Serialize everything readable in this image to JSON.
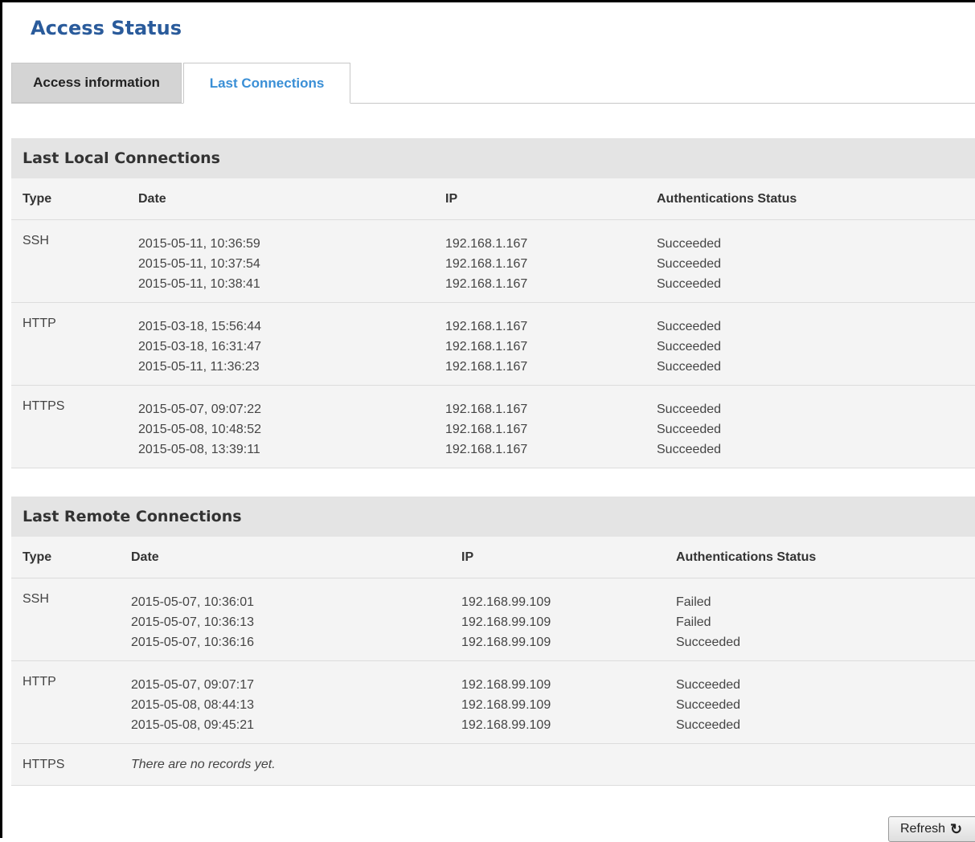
{
  "page_title": "Access Status",
  "tabs": [
    {
      "label": "Access information",
      "active": false
    },
    {
      "label": "Last Connections",
      "active": true
    }
  ],
  "columns": {
    "type": "Type",
    "date": "Date",
    "ip": "IP",
    "status": "Authentications Status"
  },
  "local": {
    "title": "Last Local Connections",
    "groups": [
      {
        "type": "SSH",
        "dates": "2015-05-11, 10:36:59\n2015-05-11, 10:37:54\n2015-05-11, 10:38:41",
        "ips": "192.168.1.167\n192.168.1.167\n192.168.1.167",
        "statuses": "Succeeded\nSucceeded\nSucceeded"
      },
      {
        "type": "HTTP",
        "dates": "2015-03-18, 15:56:44\n2015-03-18, 16:31:47\n2015-05-11, 11:36:23",
        "ips": "192.168.1.167\n192.168.1.167\n192.168.1.167",
        "statuses": "Succeeded\nSucceeded\nSucceeded"
      },
      {
        "type": "HTTPS",
        "dates": "2015-05-07, 09:07:22\n2015-05-08, 10:48:52\n2015-05-08, 13:39:11",
        "ips": "192.168.1.167\n192.168.1.167\n192.168.1.167",
        "statuses": "Succeeded\nSucceeded\nSucceeded"
      }
    ]
  },
  "remote": {
    "title": "Last Remote Connections",
    "groups": [
      {
        "type": "SSH",
        "dates": "2015-05-07, 10:36:01\n2015-05-07, 10:36:13\n2015-05-07, 10:36:16",
        "ips": "192.168.99.109\n192.168.99.109\n192.168.99.109",
        "statuses": "Failed\nFailed\nSucceeded"
      },
      {
        "type": "HTTP",
        "dates": "2015-05-07, 09:07:17\n2015-05-08, 08:44:13\n2015-05-08, 09:45:21",
        "ips": "192.168.99.109\n192.168.99.109\n192.168.99.109",
        "statuses": "Succeeded\nSucceeded\nSucceeded"
      },
      {
        "type": "HTTPS",
        "no_records": "There are no records yet."
      }
    ]
  },
  "refresh_label": "Refresh",
  "refresh_icon": "refresh-icon"
}
